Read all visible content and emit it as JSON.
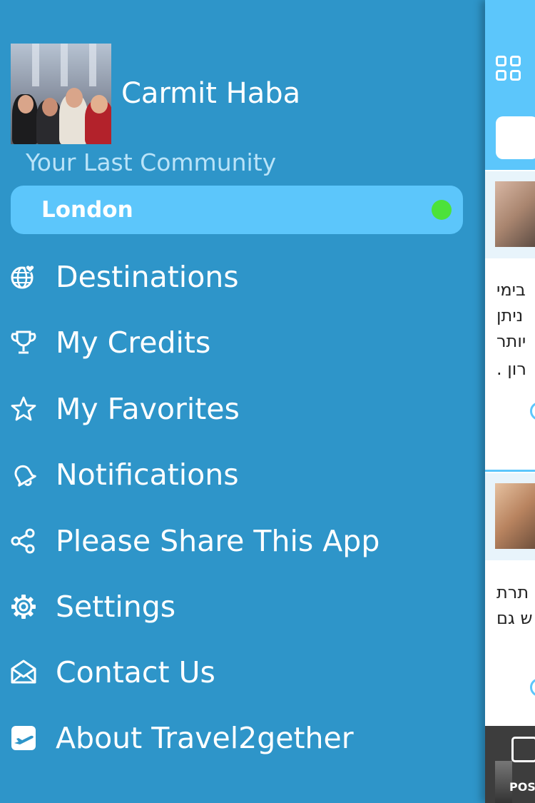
{
  "drawer": {
    "user_name": "Carmit Haba",
    "last_community_label": "Your Last Community",
    "community": {
      "name": "London",
      "status_color": "#4ce23a"
    },
    "menu": [
      {
        "label": "Destinations",
        "icon": "globe-heart-icon"
      },
      {
        "label": "My Credits",
        "icon": "trophy-icon"
      },
      {
        "label": "My Favorites",
        "icon": "star-icon"
      },
      {
        "label": "Notifications",
        "icon": "bell-icon"
      },
      {
        "label": "Please Share This App",
        "icon": "share-icon"
      },
      {
        "label": "Settings",
        "icon": "gear-icon"
      },
      {
        "label": "Contact Us",
        "icon": "envelope-icon"
      },
      {
        "label": "About Travel2gether",
        "icon": "plane-icon"
      }
    ]
  },
  "feed": {
    "post1_lines": [
      "בימי",
      "ניתן",
      "יותר",
      "רון ."
    ],
    "post2_lines": [
      "תרת",
      "ש גם"
    ],
    "post_button_label": "POS"
  },
  "colors": {
    "drawer_bg": "#2e95c9",
    "accent": "#5cc6fb",
    "online": "#4ce23a"
  }
}
